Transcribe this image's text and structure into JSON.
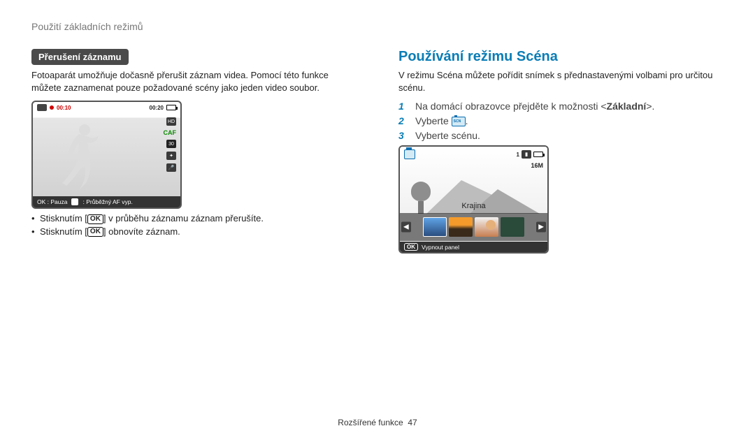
{
  "header": "Použití základních režimů",
  "left": {
    "badge": "Přerušení záznamu",
    "para": "Fotoaparát umožňuje dočasně přerušit záznam videa. Pomocí této funkce můžete zaznamenat pouze požadované scény jako jeden video soubor.",
    "rec_time_start": "00:10",
    "rec_time_end": "00:20",
    "hd": "HD",
    "caf": "CAF",
    "thirty": "30",
    "bottom_bar_ok": "OK : Pauza",
    "bottom_bar_af": ": Průběžný AF vyp.",
    "bullet1a": "Stisknutím [",
    "bullet1b": "] v průběhu záznamu záznam přerušíte.",
    "bullet2a": "Stisknutím [",
    "bullet2b": "] obnovíte záznam.",
    "ok_label": "OK"
  },
  "right": {
    "heading": "Používání režimu Scéna",
    "intro": "V režimu Scéna můžete pořídit snímek s přednastavenými volbami pro určitou scénu.",
    "steps": [
      {
        "n": "1",
        "prefix": "Na domácí obrazovce přejděte k možnosti <",
        "bold": "Základní",
        "suffix": ">."
      },
      {
        "n": "2",
        "prefix": "Vyberte ",
        "icon": true,
        "suffix": "."
      },
      {
        "n": "3",
        "prefix": "Vyberte scénu.",
        "suffix": ""
      }
    ],
    "scene_top_one": "1",
    "scene_16m": "16M",
    "scene_label": "Krajina",
    "scene_bottom_ok": "OK",
    "scene_bottom_text": "Vypnout panel"
  },
  "footer_label": "Rozšířené funkce",
  "footer_page": "47"
}
